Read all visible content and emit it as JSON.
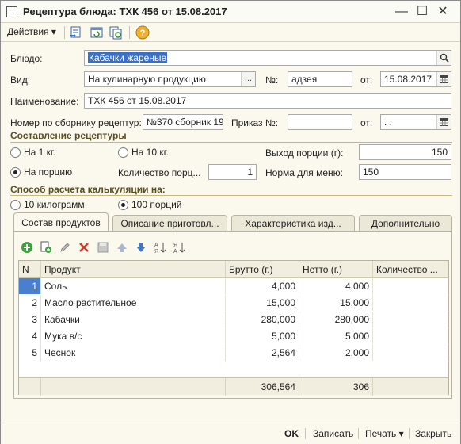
{
  "window": {
    "title": "Рецептура блюда: ТХК 456 от 15.08.2017",
    "minimize": "—",
    "maximize": "☐",
    "close": "✕"
  },
  "toolbar": {
    "actions_label": "Действия",
    "icons": [
      "post-icon",
      "refresh-icon",
      "copy-icon",
      "help-icon"
    ]
  },
  "form": {
    "dish_label": "Блюдо:",
    "dish_value": "Кабачки жареные",
    "kind_label": "Вид:",
    "kind_value": "На кулинарную продукцию",
    "number_label": "№:",
    "number_value": "адзея",
    "date_label": "от:",
    "date_value": "15.08.2017",
    "name_label": "Наименование:",
    "name_value": "ТХК 456 от 15.08.2017",
    "collection_label": "Номер по сборнику рецептур:",
    "collection_value": "№370 сборник 19",
    "order_label": "Приказ №:",
    "order_value": "",
    "order_date_label": "от:",
    "order_date_value": " .  .",
    "lookup_btn": "...",
    "search_btn": "🔍"
  },
  "recipe_section": {
    "title": "Составление рецептуры",
    "radio_1kg": "На 1 кг.",
    "radio_10kg": "На 10 кг.",
    "radio_portion": "На порцию",
    "selected": "portion",
    "yield_label": "Выход порции (г):",
    "yield_value": "150",
    "portions_label": "Количество порц...",
    "portions_value": "1",
    "menu_norm_label": "Норма для меню:",
    "menu_norm_value": "150"
  },
  "calc_section": {
    "title": "Способ расчета калькуляции на:",
    "radio_10kg": "10 килограмм",
    "radio_100": "100 порций",
    "selected": "100"
  },
  "tabs": [
    {
      "label": "Состав продуктов",
      "active": true
    },
    {
      "label": "Описание приготовл...",
      "active": false
    },
    {
      "label": "Характеристика изд...",
      "active": false
    },
    {
      "label": "Дополнительно",
      "active": false
    }
  ],
  "panel_tools": [
    "add-icon",
    "add-copy-icon",
    "edit-icon",
    "delete-icon",
    "save-icon",
    "move-up-icon",
    "move-down-icon",
    "sort-asc-icon",
    "sort-desc-icon"
  ],
  "table": {
    "columns": [
      "N",
      "Продукт",
      "Брутто (г.)",
      "Нетто (г.)",
      "Количество ..."
    ],
    "rows": [
      {
        "n": "1",
        "product": "Соль",
        "gross": "4,000",
        "net": "4,000",
        "qty": ""
      },
      {
        "n": "2",
        "product": "Масло растительное",
        "gross": "15,000",
        "net": "15,000",
        "qty": ""
      },
      {
        "n": "3",
        "product": "Кабачки",
        "gross": "280,000",
        "net": "280,000",
        "qty": ""
      },
      {
        "n": "4",
        "product": "Мука в/с",
        "gross": "5,000",
        "net": "5,000",
        "qty": ""
      },
      {
        "n": "5",
        "product": "Чеснок",
        "gross": "2,564",
        "net": "2,000",
        "qty": ""
      }
    ],
    "totals": {
      "gross": "306,564",
      "net": "306"
    }
  },
  "bottom": {
    "ok": "OK",
    "save": "Записать",
    "print": "Печать",
    "close": "Закрыть"
  },
  "colors": {
    "window_bg": "#fbf9ee",
    "section_title": "#5a4e1e",
    "selection": "#3a6fc4",
    "row_selected": "#4a7fd0"
  }
}
